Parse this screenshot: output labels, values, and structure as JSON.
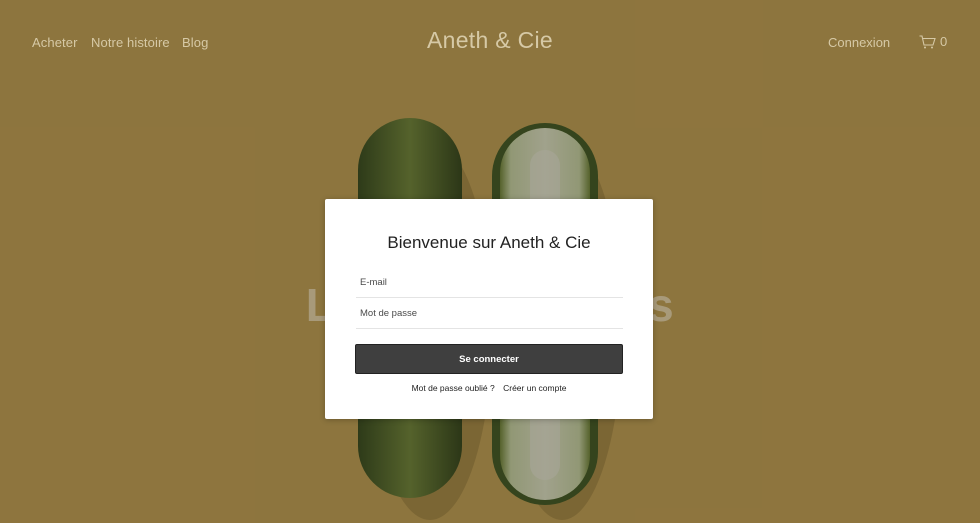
{
  "nav": {
    "links": [
      "Acheter",
      "Notre histoire",
      "Blog"
    ],
    "brand": "Aneth & Cie",
    "login": "Connexion",
    "cart_count": "0"
  },
  "hero": {
    "title": "Le super pickles"
  },
  "modal": {
    "title": "Bienvenue sur Aneth & Cie",
    "email_placeholder": "E-mail",
    "password_placeholder": "Mot de passe",
    "submit_label": "Se connecter",
    "forgot_label": "Mot de passe oublié ?",
    "signup_label": "Créer un compte"
  },
  "colors": {
    "background": "#c9a857",
    "button": "#3f3f3f"
  },
  "icons": {
    "cart": "cart-icon"
  }
}
